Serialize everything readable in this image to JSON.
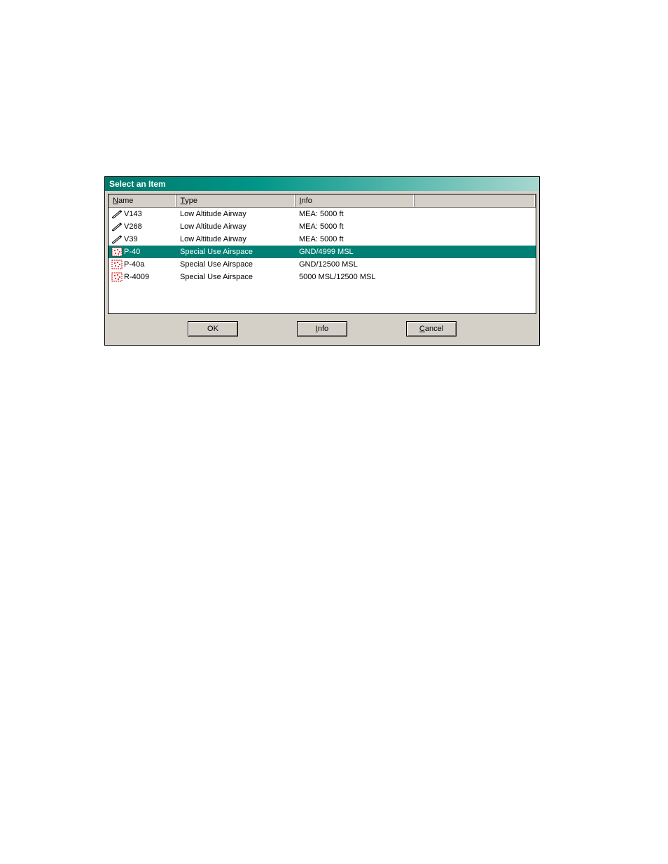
{
  "title": "Select an Item",
  "columns": [
    "Name",
    "Type",
    "Info",
    ""
  ],
  "col_accel": [
    "N",
    "T",
    "I",
    ""
  ],
  "rows": [
    {
      "icon": "airway",
      "name": "V143",
      "type": "Low Altitude Airway",
      "info": "MEA: 5000 ft",
      "selected": false
    },
    {
      "icon": "airway",
      "name": "V268",
      "type": "Low Altitude Airway",
      "info": "MEA: 5000 ft",
      "selected": false
    },
    {
      "icon": "airway",
      "name": "V39",
      "type": "Low Altitude Airway",
      "info": "MEA: 5000 ft",
      "selected": false
    },
    {
      "icon": "sua",
      "name": "P-40",
      "type": "Special Use Airspace",
      "info": "GND/4999 MSL",
      "selected": true
    },
    {
      "icon": "sua",
      "name": "P-40a",
      "type": "Special Use Airspace",
      "info": "GND/12500 MSL",
      "selected": false
    },
    {
      "icon": "sua",
      "name": "R-4009",
      "type": "Special Use Airspace",
      "info": "5000 MSL/12500 MSL",
      "selected": false
    }
  ],
  "buttons": {
    "ok": "OK",
    "info": "Info",
    "cancel": "Cancel"
  },
  "btn_accel": {
    "ok": "",
    "info": "I",
    "cancel": "C"
  }
}
